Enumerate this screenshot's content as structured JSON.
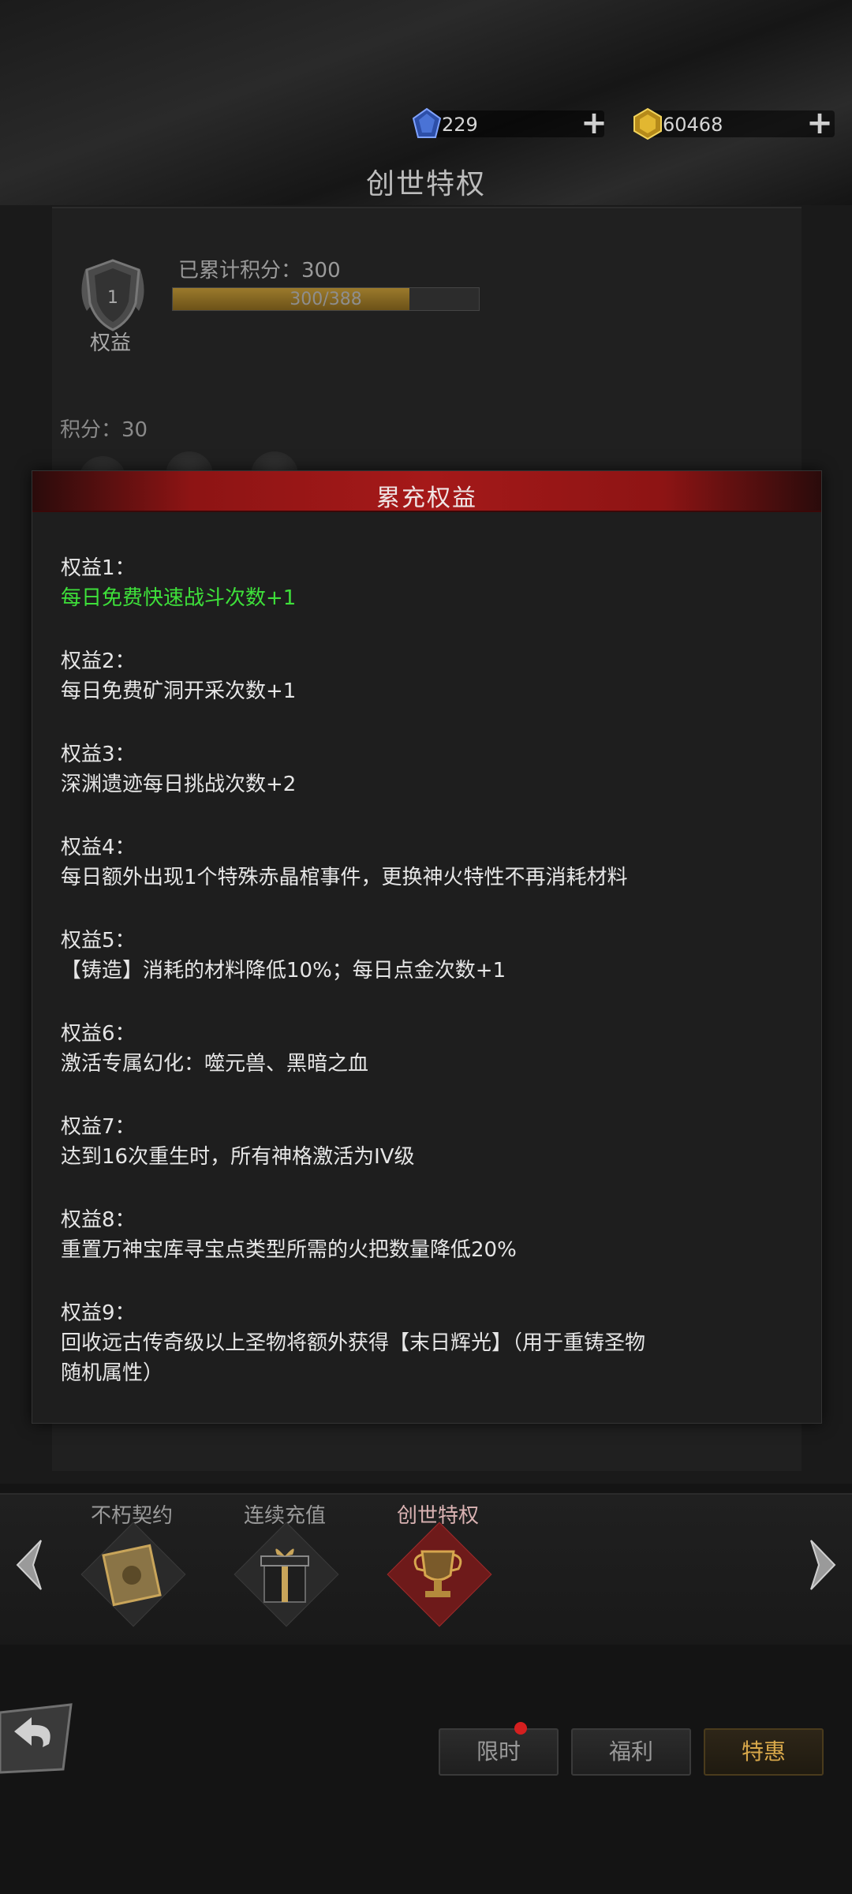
{
  "currency": {
    "diamonds": {
      "icon": "blue-gem-icon",
      "value": "229",
      "plus_label": "+"
    },
    "gold": {
      "icon": "gold-gem-icon",
      "value": "60468",
      "plus_label": "+"
    }
  },
  "page_title": "创世特权",
  "privilege": {
    "badge_level": "1",
    "badge_label": "权益",
    "accumulated_label": "已累计积分：300",
    "progress_text": "300/388",
    "progress_ratio": 0.773
  },
  "points_label": "积分：30",
  "modal": {
    "title": "累充权益",
    "benefits": [
      {
        "label": "权益1：",
        "desc": "每日免费快速战斗次数+1",
        "highlight": true
      },
      {
        "label": "权益2：",
        "desc": "每日免费矿洞开采次数+1",
        "highlight": false
      },
      {
        "label": "权益3：",
        "desc": "深渊遗迹每日挑战次数+2",
        "highlight": false
      },
      {
        "label": "权益4：",
        "desc": "每日额外出现1个特殊赤晶棺事件，更换神火特性不再消耗材料",
        "highlight": false
      },
      {
        "label": "权益5：",
        "desc": "【铸造】消耗的材料降低10%；每日点金次数+1",
        "highlight": false
      },
      {
        "label": "权益6：",
        "desc": "激活专属幻化：噬元兽、黑暗之血",
        "highlight": false
      },
      {
        "label": "权益7：",
        "desc": "达到16次重生时，所有神格激活为IV级",
        "highlight": false
      },
      {
        "label": "权益8：",
        "desc": "重置万神宝库寻宝点类型所需的火把数量降低20%",
        "highlight": false
      },
      {
        "label": "权益9：",
        "desc": "回收远古传奇级以上圣物将额外获得【末日辉光】（用于重铸圣物",
        "desc2": "随机属性）",
        "highlight": false
      }
    ]
  },
  "tabs": [
    {
      "label": "不朽契约",
      "icon": "contract-scroll-icon",
      "active": false
    },
    {
      "label": "连续充值",
      "icon": "gift-box-icon",
      "active": false
    },
    {
      "label": "创世特权",
      "icon": "trophy-icon",
      "active": true
    }
  ],
  "nav": {
    "limited": "限时",
    "welfare": "福利",
    "special": "特惠"
  },
  "colors": {
    "header_red": "#a51919",
    "highlight_green": "#3ee03a",
    "active_gold": "#d8a84a"
  }
}
